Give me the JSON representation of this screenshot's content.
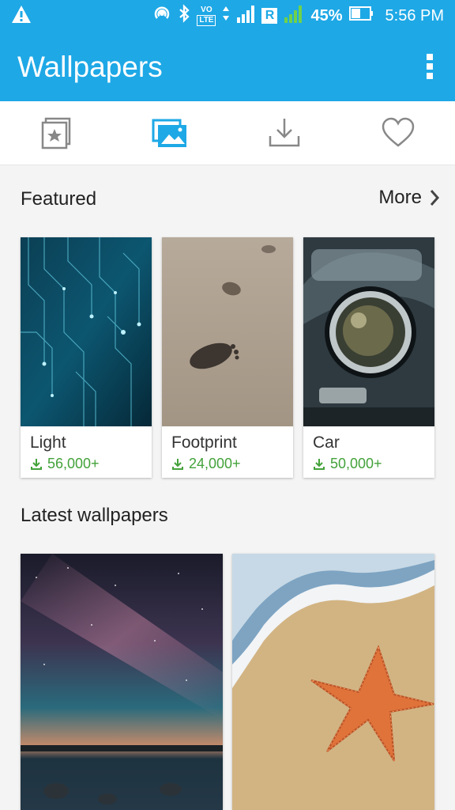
{
  "status_bar": {
    "battery": "45%",
    "time": "5:56 PM",
    "icons": [
      "alert-icon",
      "hotspot-icon",
      "bluetooth-icon",
      "volte-icon",
      "data-arrows-icon",
      "signal-icon",
      "roaming-icon",
      "signal-icon-2",
      "battery-icon"
    ],
    "volte_top": "VO",
    "volte_bottom": "LTE",
    "roaming": "R"
  },
  "app_bar": {
    "title": "Wallpapers",
    "menu_icon": "overflow-menu-icon"
  },
  "tabs": [
    {
      "icon": "collection-star-icon",
      "active": false
    },
    {
      "icon": "gallery-icon",
      "active": true
    },
    {
      "icon": "download-icon",
      "active": false
    },
    {
      "icon": "heart-icon",
      "active": false
    }
  ],
  "featured": {
    "title": "Featured",
    "more_label": "More",
    "items": [
      {
        "name": "Light",
        "downloads": "56,000+"
      },
      {
        "name": "Footprint",
        "downloads": "24,000+"
      },
      {
        "name": "Car",
        "downloads": "50,000+"
      }
    ]
  },
  "latest": {
    "title": "Latest wallpapers"
  },
  "colors": {
    "primary": "#1ea8e6",
    "download_green": "#43a23a"
  }
}
